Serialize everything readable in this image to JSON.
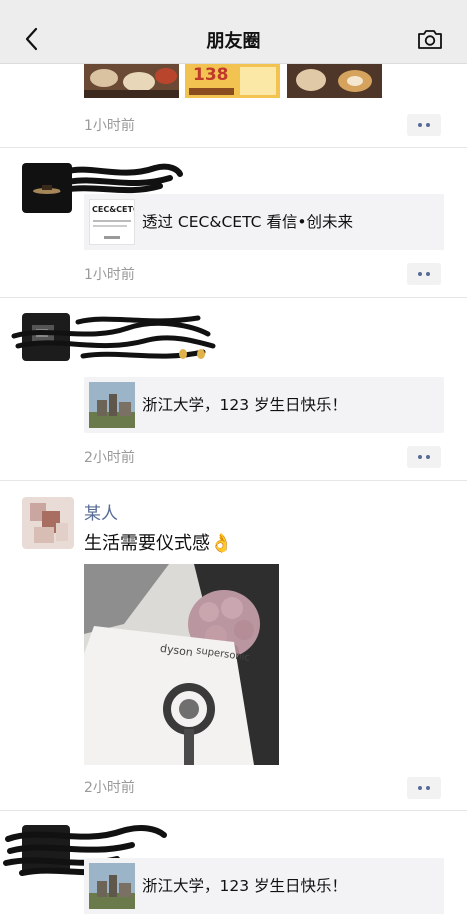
{
  "nav": {
    "title": "朋友圈",
    "back_icon": "chevron-left-icon",
    "camera_icon": "camera-icon"
  },
  "colors": {
    "nav_background": "#ededed",
    "name_link": "#576b95",
    "time_text": "#9a9a9a",
    "card_background": "#f3f3f5"
  },
  "posts": [
    {
      "time": "1小时前",
      "images": [
        "food-photo",
        "promo-poster",
        "food-photo"
      ],
      "promo_number": "138"
    },
    {
      "time": "1小时前",
      "link_title": "透过 CEC&CETC 看信•创未来",
      "link_thumb_text": "CEC&CETC"
    },
    {
      "time": "2小时前",
      "link_title": "浙江大学，123 岁生日快乐！"
    },
    {
      "name": "某人",
      "text": "生活需要仪式感",
      "emoji": "👌",
      "time": "2小时前",
      "photo": {
        "brand": "dyson",
        "product": "supersonic"
      }
    },
    {
      "link_title": "浙江大学，123 岁生日快乐！"
    }
  ]
}
